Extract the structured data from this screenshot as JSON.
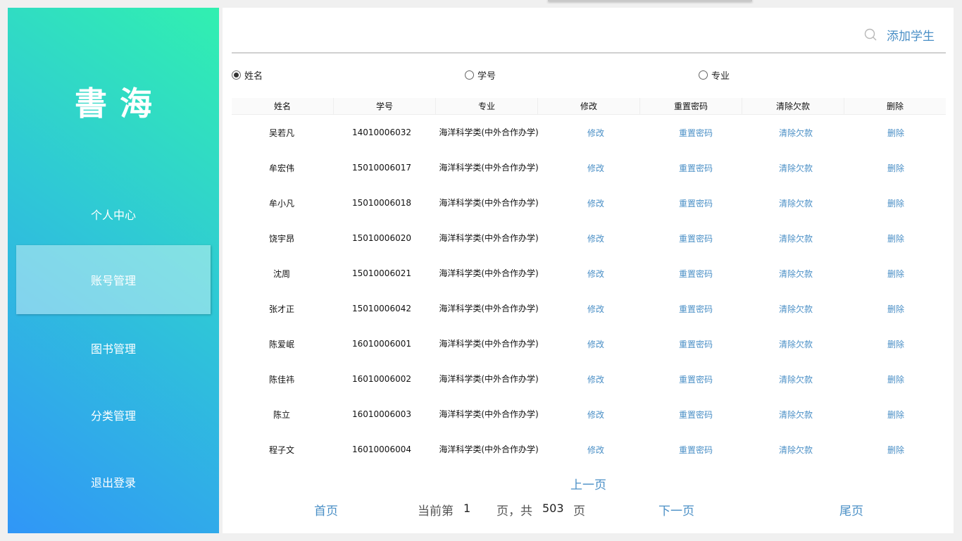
{
  "sidebar": {
    "logo_text": "書海",
    "items": [
      {
        "label": "个人中心",
        "active": false
      },
      {
        "label": "账号管理",
        "active": true
      },
      {
        "label": "图书管理",
        "active": false
      },
      {
        "label": "分类管理",
        "active": false
      },
      {
        "label": "退出登录",
        "active": false
      }
    ]
  },
  "header": {
    "add_label": "添加学生"
  },
  "search_filters": [
    {
      "label": "姓名",
      "checked": true
    },
    {
      "label": "学号",
      "checked": false
    },
    {
      "label": "专业",
      "checked": false
    }
  ],
  "table": {
    "columns": [
      "姓名",
      "学号",
      "专业",
      "修改",
      "重置密码",
      "清除欠款",
      "删除"
    ],
    "action_labels": {
      "edit": "修改",
      "reset": "重置密码",
      "clear": "清除欠款",
      "delete": "删除"
    },
    "rows": [
      {
        "name": "吴若凡",
        "id": "14010006032",
        "major": "海洋科学类(中外合作办学)"
      },
      {
        "name": "牟宏伟",
        "id": "15010006017",
        "major": "海洋科学类(中外合作办学)"
      },
      {
        "name": "牟小凡",
        "id": "15010006018",
        "major": "海洋科学类(中外合作办学)"
      },
      {
        "name": "饶宇昂",
        "id": "15010006020",
        "major": "海洋科学类(中外合作办学)"
      },
      {
        "name": "沈周",
        "id": "15010006021",
        "major": "海洋科学类(中外合作办学)"
      },
      {
        "name": "张才正",
        "id": "15010006042",
        "major": "海洋科学类(中外合作办学)"
      },
      {
        "name": "陈爱岷",
        "id": "16010006001",
        "major": "海洋科学类(中外合作办学)"
      },
      {
        "name": "陈佳祎",
        "id": "16010006002",
        "major": "海洋科学类(中外合作办学)"
      },
      {
        "name": "陈立",
        "id": "16010006003",
        "major": "海洋科学类(中外合作办学)"
      },
      {
        "name": "程子文",
        "id": "16010006004",
        "major": "海洋科学类(中外合作办学)"
      }
    ]
  },
  "pagination": {
    "prev": "上一页",
    "first": "首页",
    "current_prefix": "当前第",
    "current_page": "1",
    "total_prefix": "页，共",
    "total_pages": "503",
    "total_suffix": "页",
    "next": "下一页",
    "last": "尾页"
  },
  "colors": {
    "accent": "#4a8fc6",
    "sidebar_gradient_start": "#3096f7",
    "sidebar_gradient_end": "#31f0b0"
  }
}
